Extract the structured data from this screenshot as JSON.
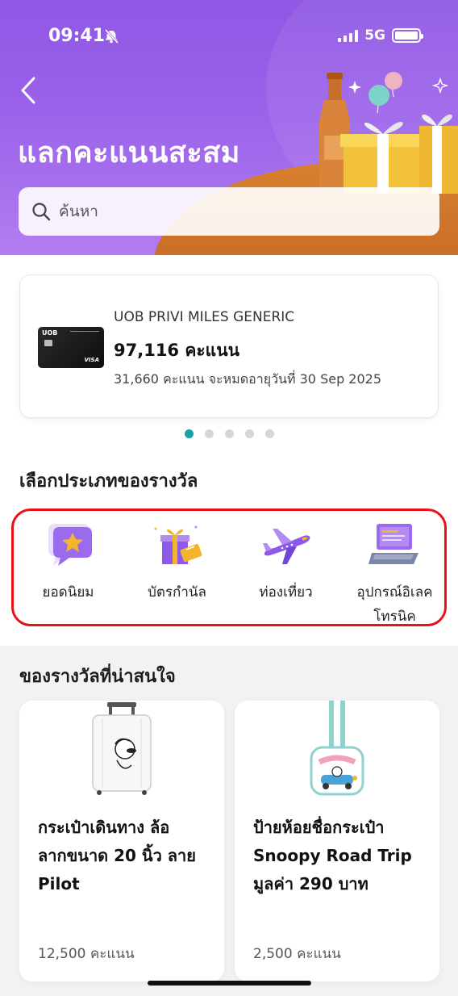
{
  "status_bar": {
    "time": "09:41",
    "network": "5G"
  },
  "header": {
    "title": "แลกคะแนนสะสม"
  },
  "search": {
    "placeholder": "ค้นหา"
  },
  "card": {
    "name": "UOB PRIVI MILES GENERIC",
    "points": "97,116 คะแนน",
    "expiry": "31,660 คะแนน จะหมดอายุวันที่ 30 Sep 2025",
    "card_logo": "UOB",
    "card_brand": "VISA"
  },
  "carousel": {
    "count": 5,
    "active_index": 0
  },
  "categories": {
    "title": "เลือกประเภทของรางวัล",
    "items": [
      {
        "label": "ยอดนิยม",
        "icon": "star-chat-icon"
      },
      {
        "label": "บัตรกำนัล",
        "icon": "gift-voucher-icon"
      },
      {
        "label": "ท่องเที่ยว",
        "icon": "airplane-icon"
      },
      {
        "label": "อุปกรณ์อิเลคโทรนิค",
        "line1": "อุปกรณ์อิเลค",
        "line2": "โทรนิค",
        "icon": "laptop-icon"
      }
    ]
  },
  "rewards": {
    "title": "ของรางวัลที่น่าสนใจ",
    "items": [
      {
        "line1": "กระเป๋าเดินทาง ล้อ",
        "line2": "ลากขนาด 20 นิ้ว ลาย",
        "line3": "Pilot",
        "points": "12,500 คะแนน"
      },
      {
        "line1": "ป้ายห้อยชื่อกระเป๋า",
        "line2": "Snoopy Road Trip",
        "line3": "มูลค่า 290 บาท",
        "points": "2,500 คะแนน"
      }
    ]
  },
  "colors": {
    "header_purple": "#9b63ea",
    "accent_teal": "#17a2a4",
    "highlight_red": "#e8121c"
  }
}
